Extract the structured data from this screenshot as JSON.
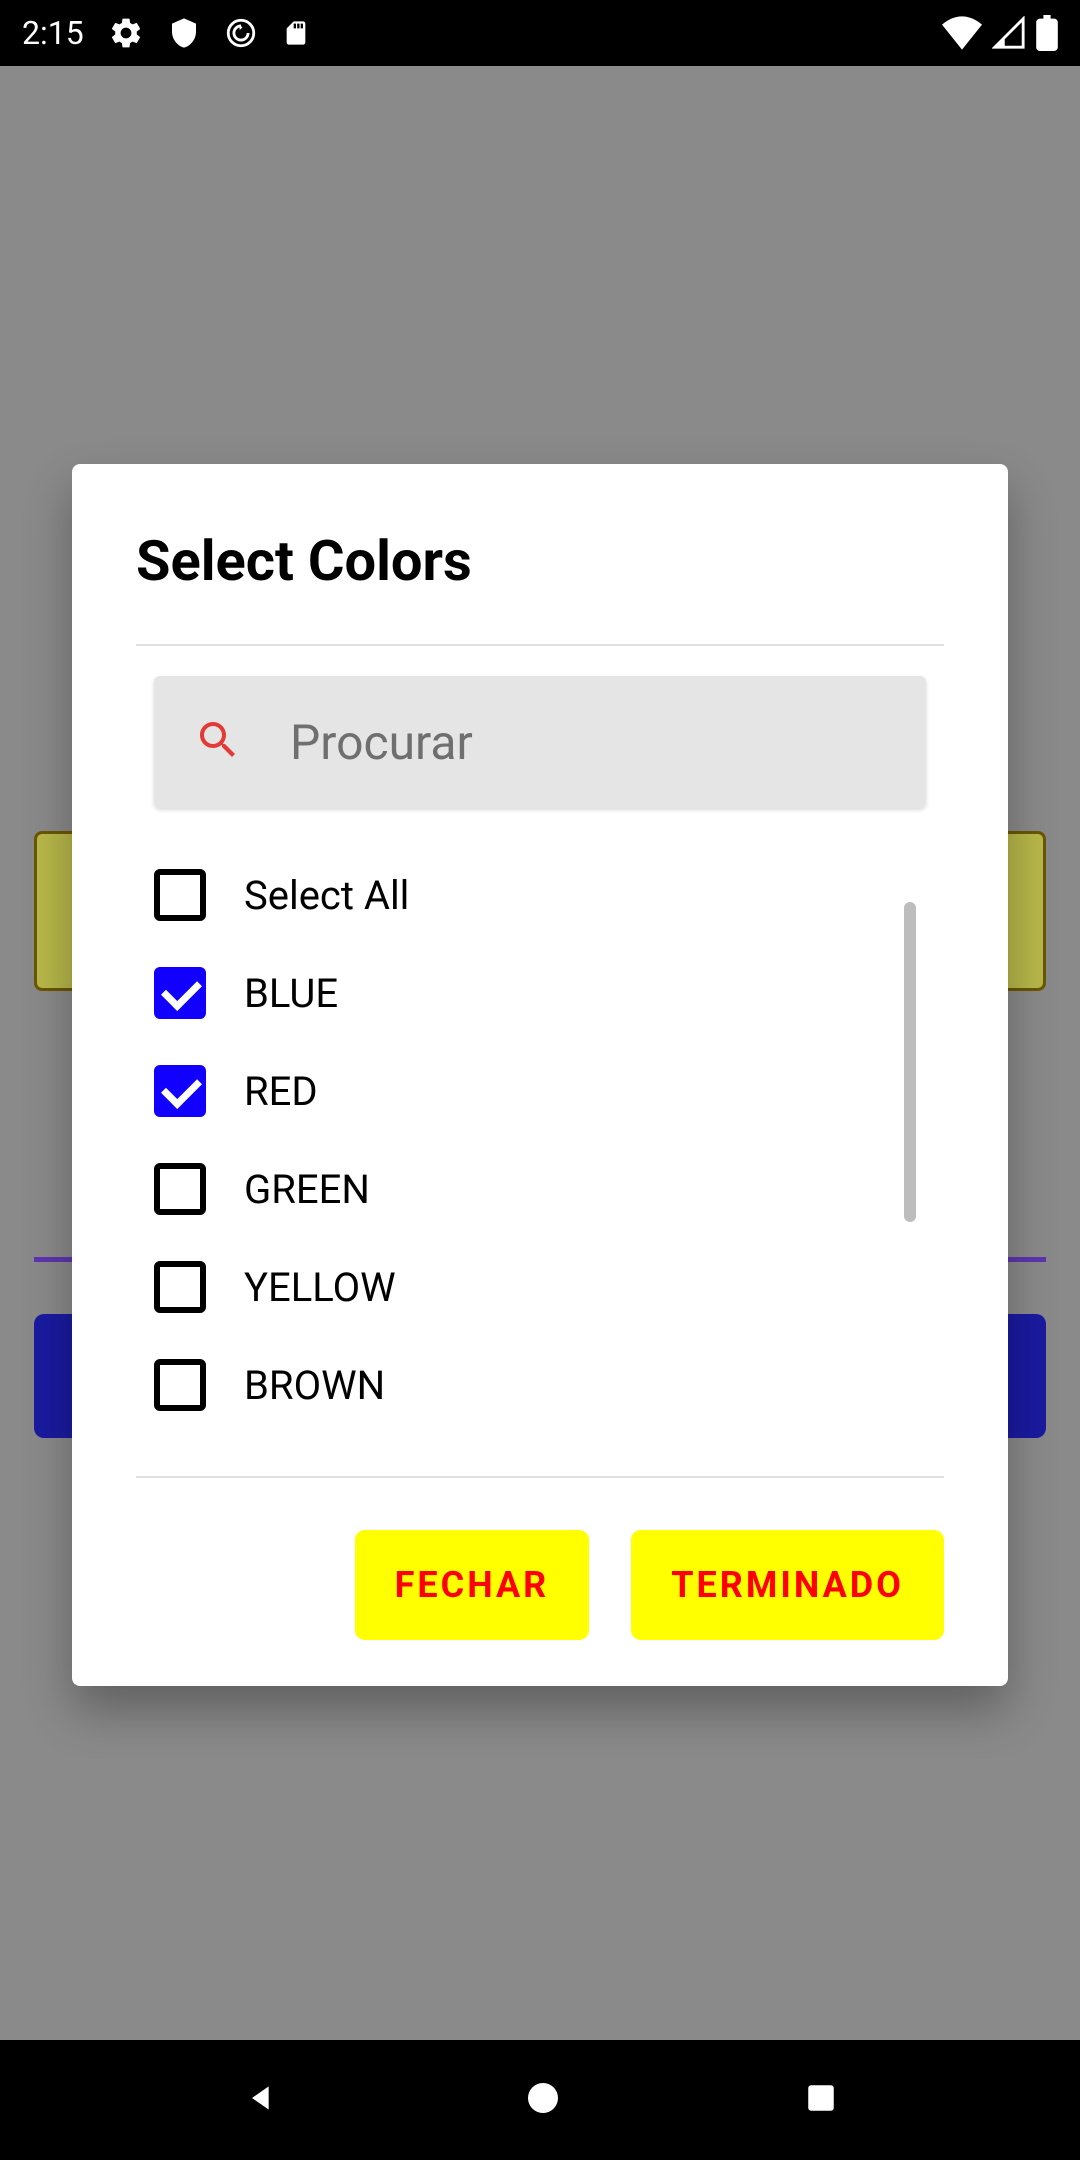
{
  "statusBar": {
    "time": "2:15"
  },
  "dialog": {
    "title": "Select Colors",
    "search": {
      "placeholder": "Procurar"
    },
    "selectAll": {
      "label": "Select All",
      "checked": false
    },
    "items": [
      {
        "label": "BLUE",
        "checked": true
      },
      {
        "label": "RED",
        "checked": true
      },
      {
        "label": "GREEN",
        "checked": false
      },
      {
        "label": "YELLOW",
        "checked": false
      },
      {
        "label": "BROWN",
        "checked": false
      }
    ],
    "buttons": {
      "close": "FECHAR",
      "done": "TERMINADO"
    }
  },
  "colors": {
    "checkboxChecked": "#1200ff",
    "buttonBg": "#ffff00",
    "buttonText": "#ff0000",
    "searchIcon": "#e53935"
  }
}
